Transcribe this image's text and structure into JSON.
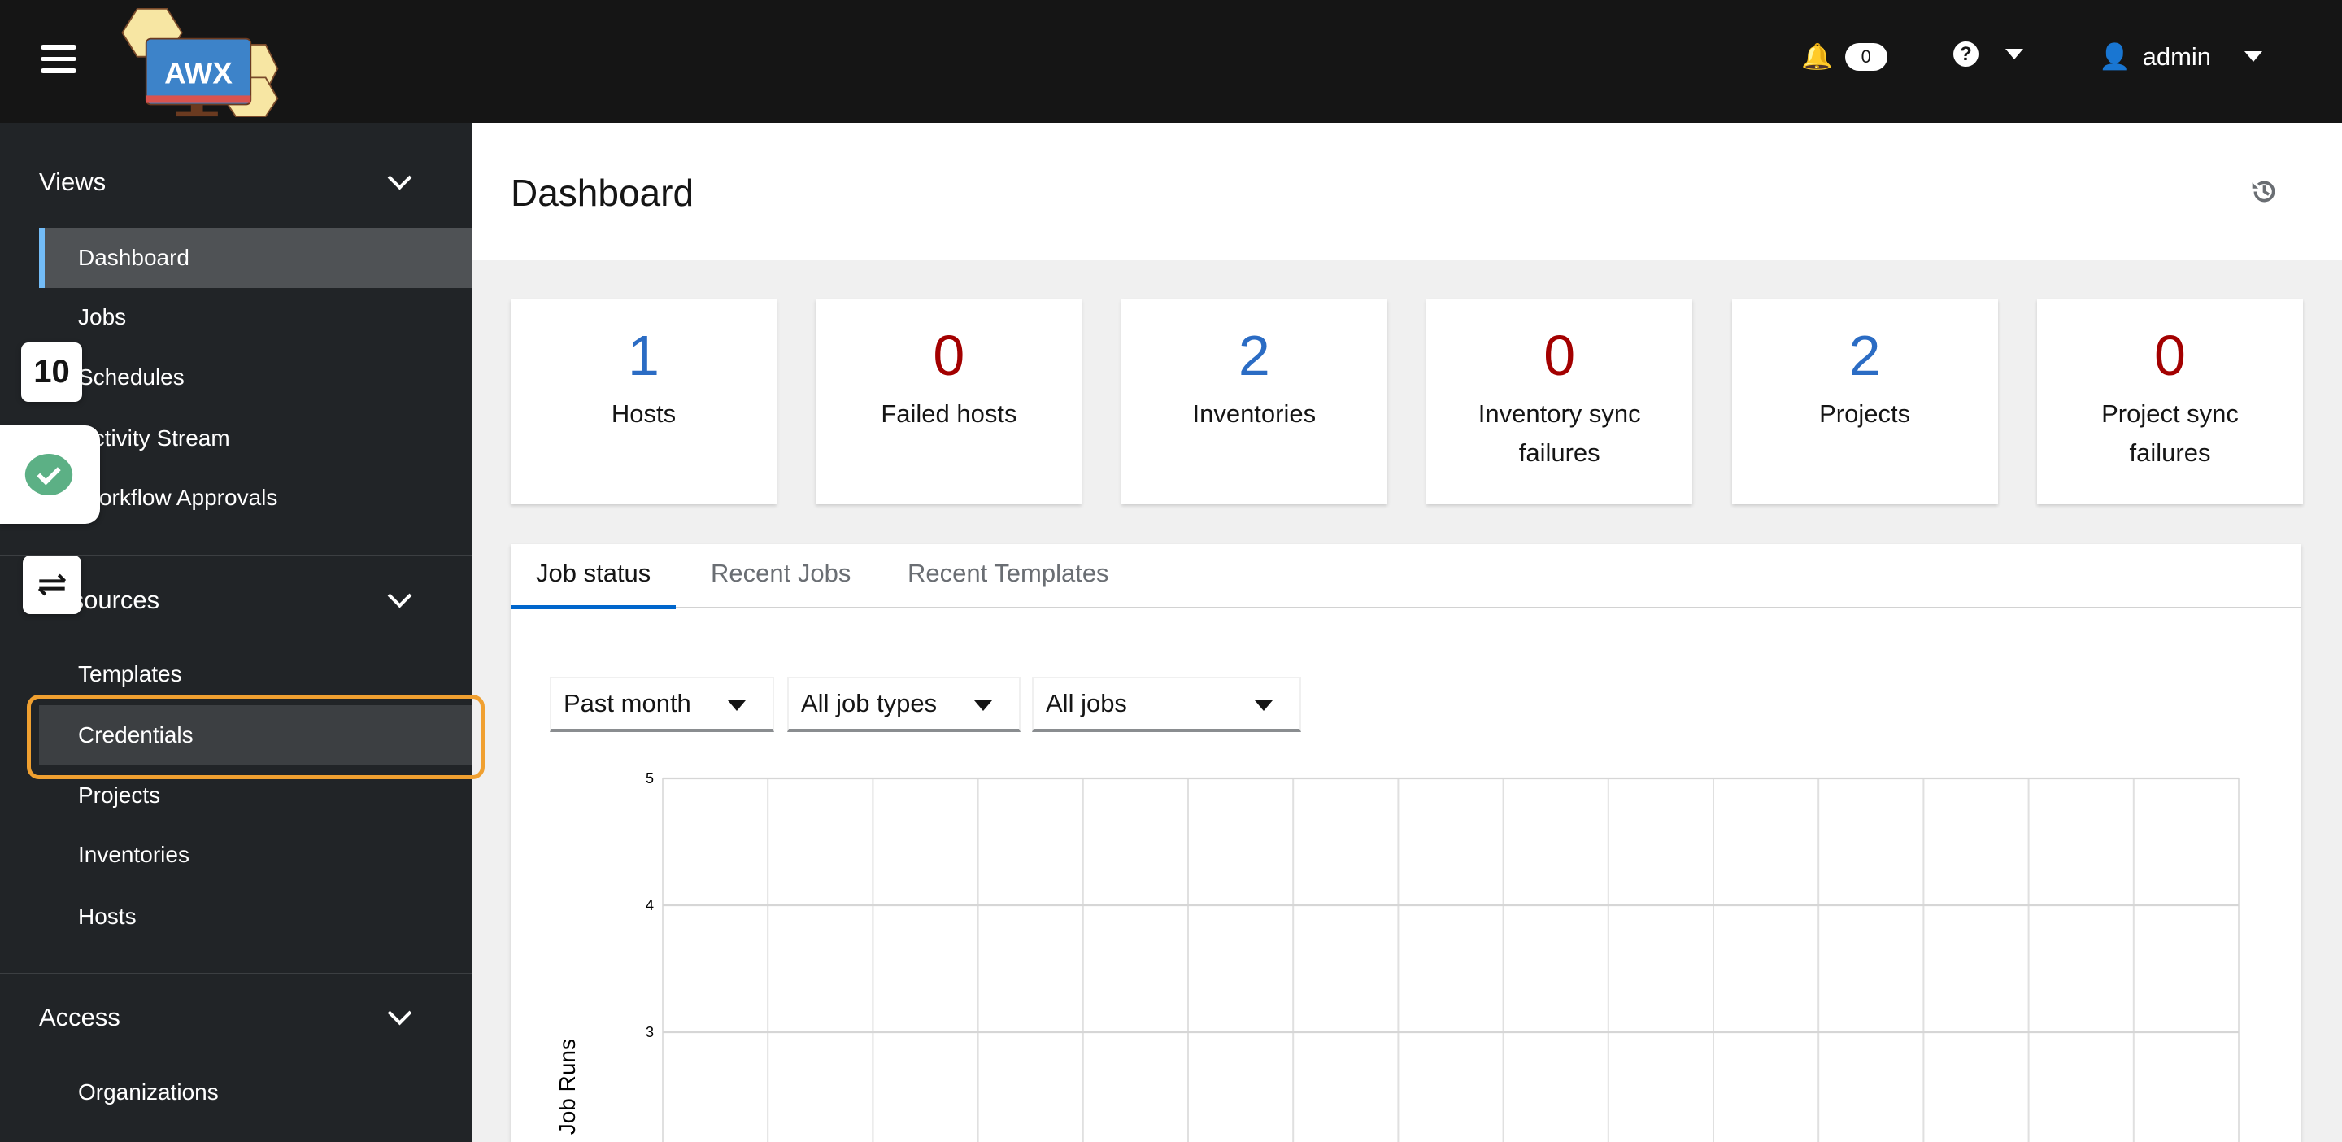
{
  "header": {
    "logo_text": "AWX",
    "notification_count": "0",
    "user": "admin"
  },
  "sidebar": {
    "sections": [
      {
        "label": "Views",
        "items": [
          "Dashboard",
          "Jobs",
          "Schedules",
          "Activity Stream",
          "Workflow Approvals"
        ]
      },
      {
        "label": "Resources",
        "items": [
          "Templates",
          "Credentials",
          "Projects",
          "Inventories",
          "Hosts"
        ]
      },
      {
        "label": "Access",
        "items": [
          "Organizations"
        ]
      }
    ],
    "active_item": "Dashboard",
    "highlighted_item": "Credentials"
  },
  "overlays": {
    "counter_badge": "10"
  },
  "main": {
    "title": "Dashboard",
    "cards": [
      {
        "value": "1",
        "label": "Hosts",
        "color": "#2b6cc4"
      },
      {
        "value": "0",
        "label": "Failed hosts",
        "color": "#a30000"
      },
      {
        "value": "2",
        "label": "Inventories",
        "color": "#2b6cc4"
      },
      {
        "value": "0",
        "label": "Inventory sync failures",
        "color": "#a30000"
      },
      {
        "value": "2",
        "label": "Projects",
        "color": "#2b6cc4"
      },
      {
        "value": "0",
        "label": "Project sync failures",
        "color": "#a30000"
      }
    ],
    "tabs": [
      "Job status",
      "Recent Jobs",
      "Recent Templates"
    ],
    "filters": [
      "Past month",
      "All job types",
      "All jobs"
    ]
  },
  "chart_data": {
    "type": "line",
    "ylabel": "Job Runs",
    "yticks": [
      5,
      4,
      3
    ],
    "ylim": [
      0,
      5
    ],
    "grid": true,
    "vertical_gridlines": 15,
    "series": []
  }
}
